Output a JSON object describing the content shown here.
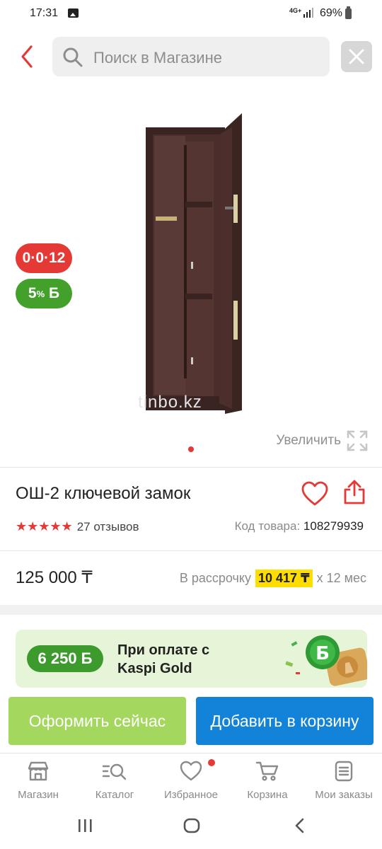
{
  "status_bar": {
    "time": "17:31",
    "network": "4G+",
    "battery": "69%"
  },
  "header": {
    "search_placeholder": "Поиск в Магазине"
  },
  "gallery": {
    "installment_badge": "0·0·12",
    "bonus_badge_number": "5",
    "bonus_badge_pct": "%",
    "bonus_badge_symbol": "Б",
    "watermark": "tinbo.kz",
    "zoom_label": "Увеличить"
  },
  "product": {
    "title": "ОШ-2 ключевой замок",
    "stars": "★★★★★",
    "rating": 5,
    "reviews": "27 отзывов",
    "code_label": "Код товара:",
    "code_value": "108279939",
    "price": "125 000 ₸",
    "installment_prefix": "В рассрочку",
    "installment_amount": "10 417 ₸",
    "installment_suffix": "x 12 мес"
  },
  "promo": {
    "bonus": "6 250 Б",
    "line1": "При оплате с",
    "line2": "Kaspi Gold"
  },
  "actions": {
    "buy_now": "Оформить сейчас",
    "add_to_cart": "Добавить в корзину"
  },
  "bottom_nav": {
    "shop": "Магазин",
    "catalog": "Каталог",
    "favorites": "Избранное",
    "cart": "Корзина",
    "orders": "Мои заказы"
  },
  "colors": {
    "accent_red": "#e53935",
    "green": "#43a02b",
    "blue": "#1383d9",
    "light_green": "#a4d75e",
    "yellow": "#ffdd00"
  }
}
